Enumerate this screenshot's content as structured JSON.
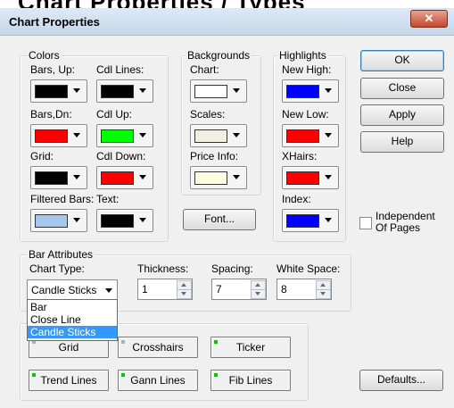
{
  "top_heading": "Chart Properties / Types",
  "dialog": {
    "title": "Chart Properties",
    "close_glyph": "✕"
  },
  "colors_group": {
    "label": "Colors",
    "items": [
      {
        "label": "Bars, Up:",
        "color": "#000000"
      },
      {
        "label": "Cdl Lines:",
        "color": "#000000"
      },
      {
        "label": "Bars,Dn:",
        "color": "#ff0000"
      },
      {
        "label": "Cdl Up:",
        "color": "#00ff00"
      },
      {
        "label": "Grid:",
        "color": "#000000"
      },
      {
        "label": "Cdl Down:",
        "color": "#ff0000"
      },
      {
        "label": "Filtered Bars:",
        "color": "#a6c8ec"
      },
      {
        "label": "Text:",
        "color": "#000000"
      }
    ]
  },
  "backgrounds_group": {
    "label": "Backgrounds",
    "items": [
      {
        "label": "Chart:",
        "color": "#ffffff"
      },
      {
        "label": "Scales:",
        "color": "#f0f0e1"
      },
      {
        "label": "Price Info:",
        "color": "#ffffe1"
      }
    ],
    "font_button": "Font..."
  },
  "highlights_group": {
    "label": "Highlights",
    "items": [
      {
        "label": "New High:",
        "color": "#0000ff"
      },
      {
        "label": "New Low:",
        "color": "#ff0000"
      },
      {
        "label": "XHairs:",
        "color": "#ff0000"
      },
      {
        "label": "Index:",
        "color": "#0000ff"
      }
    ]
  },
  "buttons": {
    "ok": "OK",
    "close": "Close",
    "apply": "Apply",
    "help": "Help",
    "defaults": "Defaults..."
  },
  "independent": {
    "label_line1": "Independent",
    "label_line2": "Of Pages",
    "checked": false
  },
  "bar_attributes": {
    "label": "Bar Attributes",
    "chart_type_label": "Chart Type:",
    "chart_type_value": "Candle Sticks",
    "chart_type_options": [
      "Bar",
      "Close Line",
      "Candle Sticks"
    ],
    "thickness_label": "Thickness:",
    "thickness_value": "1",
    "spacing_label": "Spacing:",
    "spacing_value": "7",
    "white_space_label": "White Space:",
    "white_space_value": "8"
  },
  "toggles": {
    "grid": {
      "label": "Grid",
      "on": false
    },
    "crosshairs": {
      "label": "Crosshairs",
      "on": false
    },
    "ticker": {
      "label": "Ticker",
      "on": true
    },
    "trend_lines": {
      "label": "Trend Lines",
      "on": true
    },
    "gann_lines": {
      "label": "Gann Lines",
      "on": true
    },
    "fib_lines": {
      "label": "Fib Lines",
      "on": true
    },
    "on_color": "#00cc00",
    "off_color": "#b0b0b0"
  }
}
